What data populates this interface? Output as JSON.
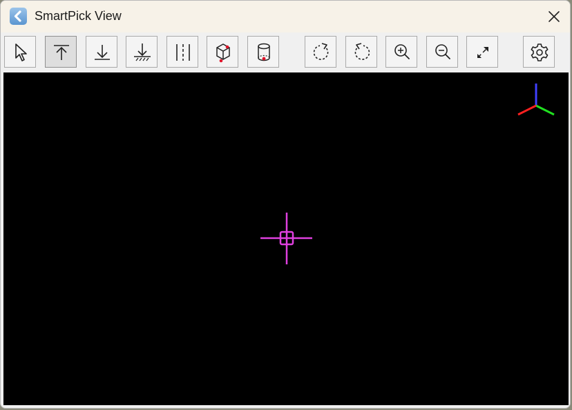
{
  "window": {
    "title": "SmartPick View"
  },
  "toolbar": {
    "buttons": [
      {
        "name": "select-tool-button",
        "icon": "select-arrow-icon",
        "active": false
      },
      {
        "name": "snap-top-button",
        "icon": "snap-top-icon",
        "active": true
      },
      {
        "name": "snap-bottom-button",
        "icon": "snap-bottom-icon",
        "active": false
      },
      {
        "name": "snap-surface-button",
        "icon": "snap-surface-icon",
        "active": false
      },
      {
        "name": "snap-axis-button",
        "icon": "snap-axis-icon",
        "active": false
      },
      {
        "name": "pick-box-button",
        "icon": "box-point-icon",
        "active": false
      },
      {
        "name": "pick-cylinder-button",
        "icon": "cylinder-point-icon",
        "active": false
      },
      {
        "name": "rotate-clockwise-button",
        "icon": "rotate-clockwise-icon",
        "active": false
      },
      {
        "name": "rotate-counterclockwise-button",
        "icon": "rotate-counterclockwise-icon",
        "active": false
      },
      {
        "name": "zoom-in-button",
        "icon": "zoom-in-icon",
        "active": false
      },
      {
        "name": "zoom-out-button",
        "icon": "zoom-out-icon",
        "active": false
      },
      {
        "name": "fit-view-button",
        "icon": "expand-icon",
        "active": false
      },
      {
        "name": "settings-button",
        "icon": "gear-icon",
        "active": false
      }
    ]
  },
  "viewport": {
    "background": "#000000",
    "crosshair_color": "#e040e0",
    "axes_colors": {
      "x": "#ff2020",
      "y": "#20e020",
      "z": "#4040ff"
    }
  },
  "colors": {
    "titlebar": "#f7f2e8",
    "toolbar": "#f0f0f0",
    "icon_accent_red": "#e0142a"
  }
}
